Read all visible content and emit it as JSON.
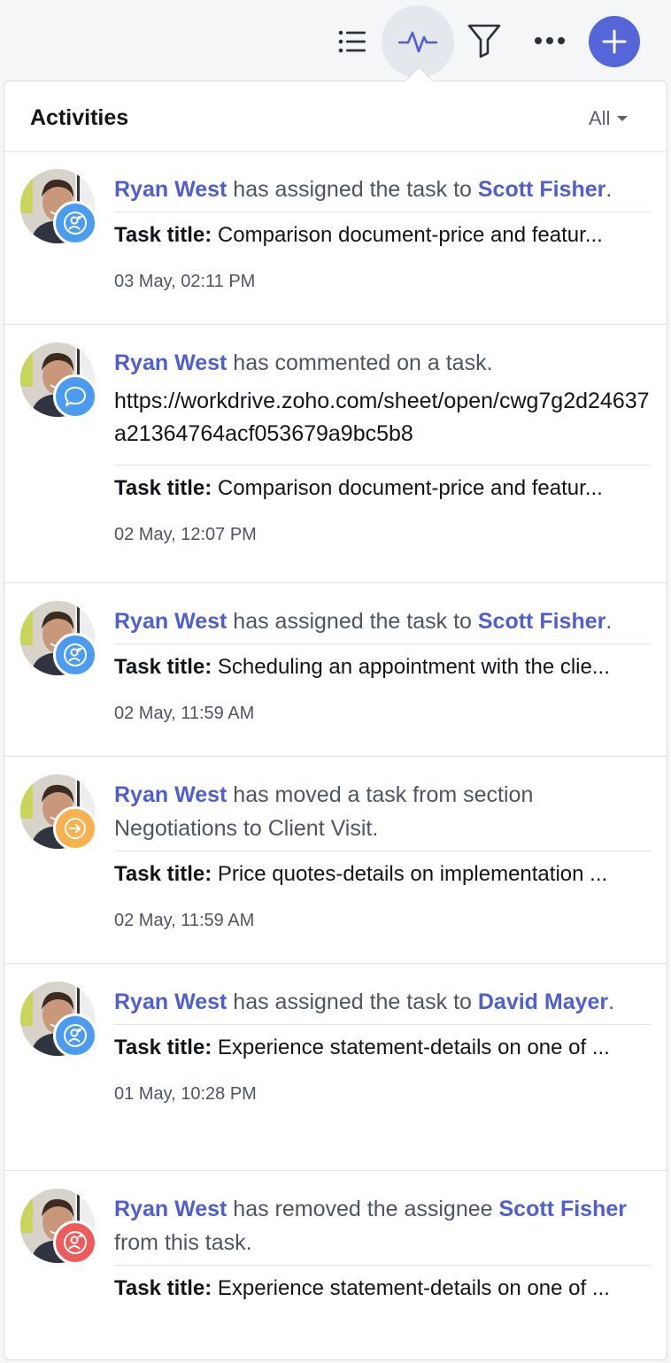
{
  "toolbar": {
    "icons": [
      "list-icon",
      "activity-icon",
      "filter-icon",
      "more-icon",
      "add-icon"
    ],
    "accent": "#5567d8"
  },
  "panel": {
    "title": "Activities",
    "filter_value": "All"
  },
  "activities": [
    {
      "actor": "Ryan West",
      "action": " has assigned the task to ",
      "target": "Scott Fisher",
      "suffix": ".",
      "badge": "assign-icon",
      "task_label": "Task title:",
      "task_title": "Comparison document-price and featur...",
      "timestamp": "03 May, 02:11 PM"
    },
    {
      "actor": "Ryan West",
      "action": " has commented on a task.",
      "body": "https://workdrive.zoho.com/sheet/open/cwg7g2d24637a21364764acf053679a9bc5b8",
      "badge": "comment-icon",
      "task_label": "Task title:",
      "task_title": "Comparison document-price and featur...",
      "timestamp": "02 May, 12:07 PM"
    },
    {
      "actor": "Ryan West",
      "action": " has assigned the task to ",
      "target": "Scott Fisher",
      "suffix": ".",
      "badge": "assign-icon",
      "task_label": "Task title:",
      "task_title": "Scheduling an appointment with the clie...",
      "timestamp": "02 May, 11:59 AM"
    },
    {
      "actor": "Ryan West",
      "action": " has moved a task from section Negotiations to Client Visit.",
      "badge": "move-icon",
      "task_label": "Task title:",
      "task_title": "Price quotes-details on implementation ...",
      "timestamp": "02 May, 11:59 AM"
    },
    {
      "actor": "Ryan West",
      "action": " has assigned the task to ",
      "target": "David Mayer",
      "suffix": ".",
      "badge": "assign-icon",
      "task_label": "Task title:",
      "task_title": "Experience statement-details on one of ...",
      "timestamp": "01 May, 10:28 PM"
    },
    {
      "actor": "Ryan West",
      "action": " has removed the assignee ",
      "target": "Scott Fisher",
      "suffix": " from this task.",
      "badge": "unassign-icon",
      "task_label": "Task title:",
      "task_title": "Experience statement-details on one of ..."
    }
  ]
}
